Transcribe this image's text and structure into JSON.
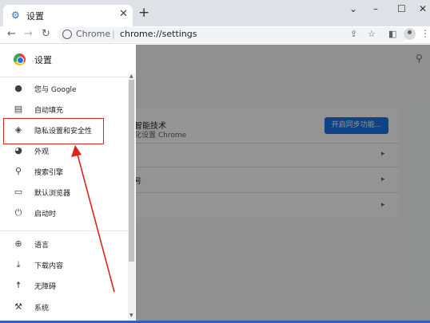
{
  "tab": {
    "title": "设置",
    "close": "✕"
  },
  "window_controls": {
    "minimize": "–",
    "maximize": "☐",
    "close": "✕",
    "dropdown": "⌄"
  },
  "toolbar": {
    "back": "←",
    "forward": "→",
    "reload": "↻",
    "site_name": "Chrome",
    "separator": "|",
    "url": "chrome://settings",
    "new_tab": "+"
  },
  "drawer": {
    "title": "设置",
    "items": [
      {
        "label": "您与 Google",
        "icon": "person-icon",
        "glyph": "●"
      },
      {
        "label": "自动填充",
        "icon": "clipboard-icon",
        "glyph": "▤"
      },
      {
        "label": "隐私设置和安全性",
        "icon": "shield-icon",
        "glyph": "◈"
      },
      {
        "label": "外观",
        "icon": "palette-icon",
        "glyph": "◕"
      },
      {
        "label": "搜索引擎",
        "icon": "search-icon",
        "glyph": "⚲"
      },
      {
        "label": "默认浏览器",
        "icon": "browser-icon",
        "glyph": "▭"
      },
      {
        "label": "启动时",
        "icon": "power-icon",
        "glyph": "⏻"
      },
      {
        "label": "语言",
        "icon": "globe-icon",
        "glyph": "⊕"
      },
      {
        "label": "下载内容",
        "icon": "download-icon",
        "glyph": "⤓"
      },
      {
        "label": "无障碍",
        "icon": "accessibility-icon",
        "glyph": "☨"
      },
      {
        "label": "系统",
        "icon": "wrench-icon",
        "glyph": "⚒"
      }
    ]
  },
  "main": {
    "card_title": "智能技术",
    "card_subtitle": "化设置 Chrome",
    "sync_button": "开启同步功能...",
    "row2_label": "",
    "row3_label": "号",
    "chevron": "▸"
  },
  "colors": {
    "accent": "#1a73e8",
    "annotation": "#d9261c"
  }
}
